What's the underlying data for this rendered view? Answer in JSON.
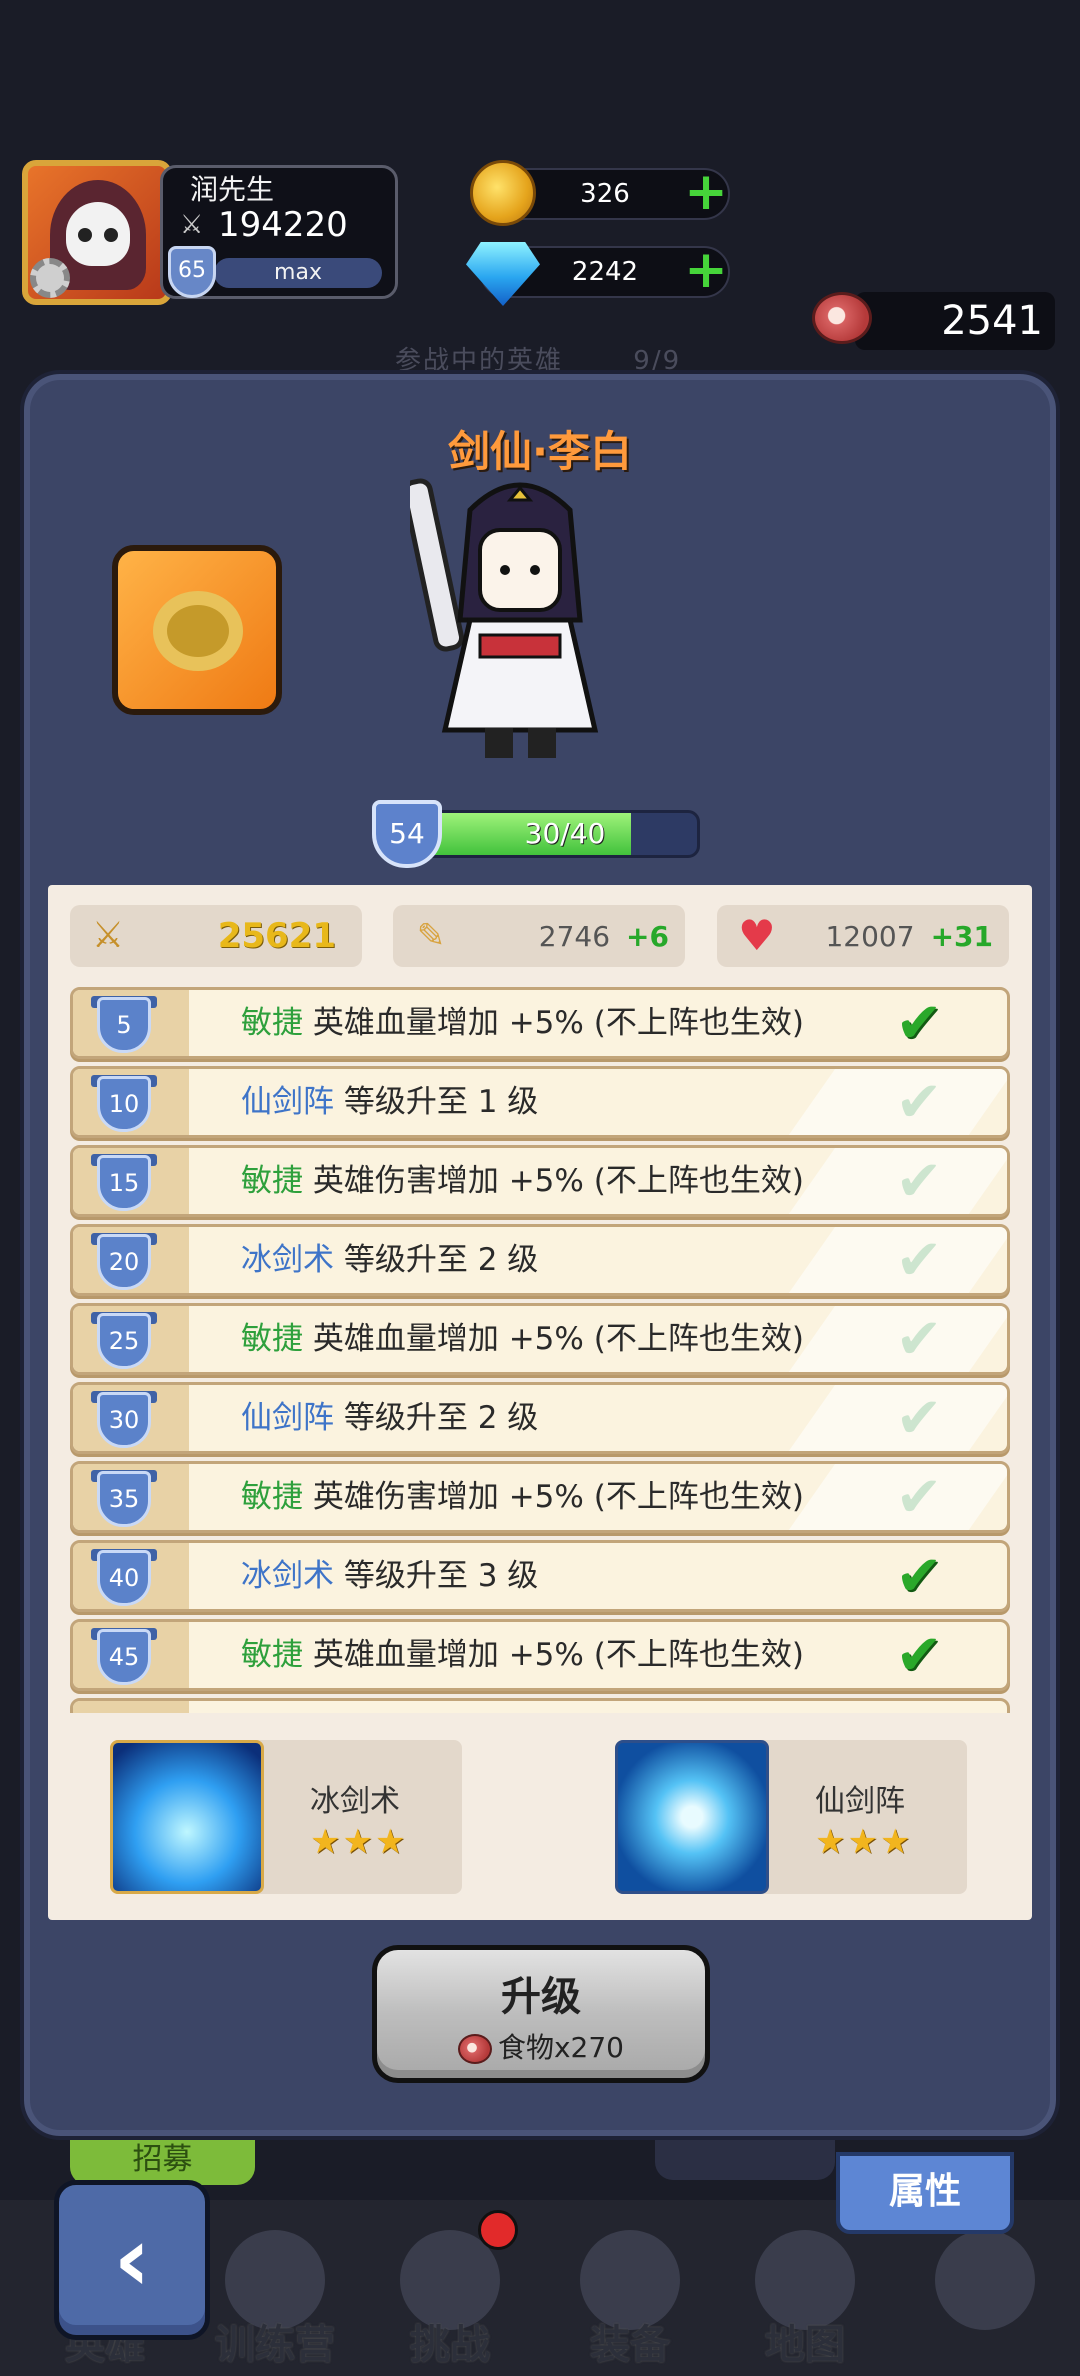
{
  "player": {
    "name": "润先生",
    "power": "194220",
    "level": "65",
    "level_status": "max"
  },
  "resources": {
    "gold": "326",
    "diamonds": "2242",
    "food": "2541"
  },
  "background_header": "参战中的英雄",
  "background_count": "9/9",
  "hero": {
    "title": "剑仙·李白",
    "level": "54",
    "exp_text": "30/40",
    "exp_fraction": 0.75
  },
  "stats": {
    "power": "25621",
    "attack": "2746",
    "attack_bonus": "+6",
    "hp": "12007",
    "hp_bonus": "+31"
  },
  "upgrades": [
    {
      "level": "5",
      "tag": "敏捷",
      "tag_color": "green",
      "text": "英雄血量增加 +5% (不上阵也生效)",
      "done": true
    },
    {
      "level": "10",
      "tag": "仙剑阵",
      "tag_color": "blue",
      "text": "等级升至 1 级",
      "done": false
    },
    {
      "level": "15",
      "tag": "敏捷",
      "tag_color": "green",
      "text": "英雄伤害增加 +5% (不上阵也生效)",
      "done": false
    },
    {
      "level": "20",
      "tag": "冰剑术",
      "tag_color": "blue",
      "text": "等级升至 2 级",
      "done": false
    },
    {
      "level": "25",
      "tag": "敏捷",
      "tag_color": "green",
      "text": "英雄血量增加 +5% (不上阵也生效)",
      "done": false
    },
    {
      "level": "30",
      "tag": "仙剑阵",
      "tag_color": "blue",
      "text": "等级升至 2 级",
      "done": false
    },
    {
      "level": "35",
      "tag": "敏捷",
      "tag_color": "green",
      "text": "英雄伤害增加 +5% (不上阵也生效)",
      "done": false
    },
    {
      "level": "40",
      "tag": "冰剑术",
      "tag_color": "blue",
      "text": "等级升至 3 级",
      "done": true
    },
    {
      "level": "45",
      "tag": "敏捷",
      "tag_color": "green",
      "text": "英雄血量增加 +5% (不上阵也生效)",
      "done": true
    }
  ],
  "skills": [
    {
      "name": "冰剑术",
      "stars": "★★★"
    },
    {
      "name": "仙剑阵",
      "stars": "★★★"
    }
  ],
  "upgrade_button": {
    "label": "升级",
    "cost": "食物x270"
  },
  "peek_left": "招募",
  "attribute_tab": "属性",
  "bottom_nav": [
    "英雄",
    "训练营",
    "挑战",
    "装备",
    "地图",
    ""
  ],
  "colors": {
    "tag_green": "#2ea03c",
    "tag_blue": "#3e74c8",
    "check_on": "#2aa82a"
  }
}
